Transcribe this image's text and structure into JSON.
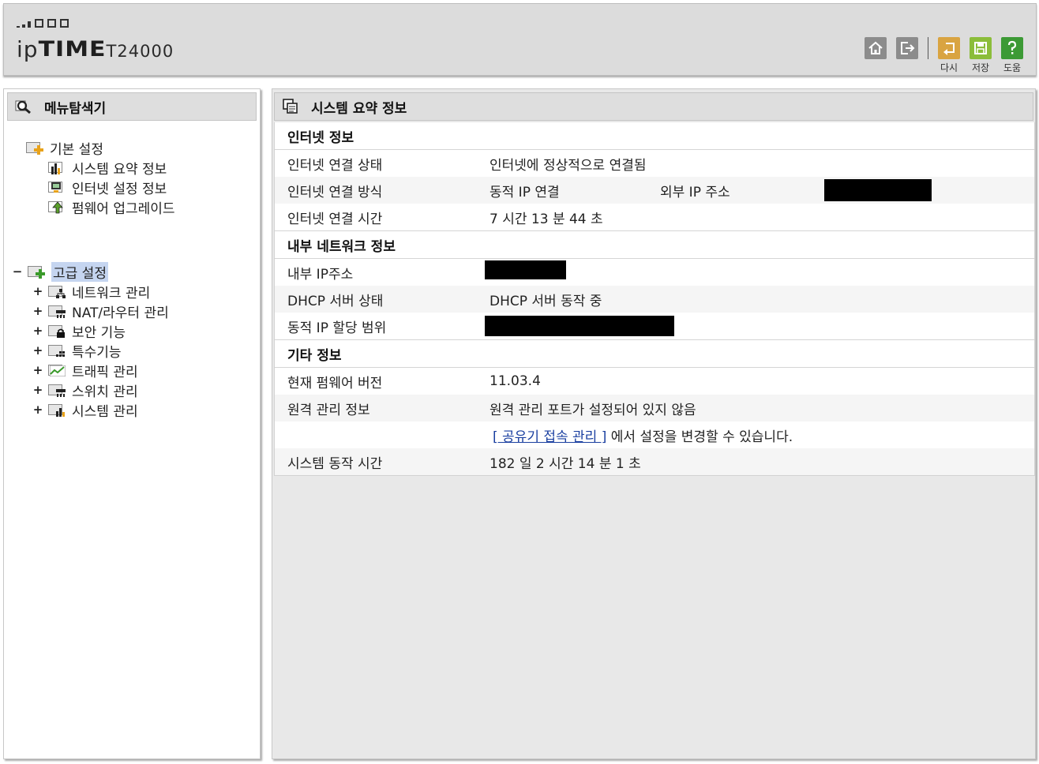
{
  "header": {
    "logo_ip": "ip",
    "logo_time": "TIME",
    "logo_model": "T24000",
    "buttons": {
      "home_label": "",
      "logout_label": "",
      "reload_label": "다시",
      "save_label": "저장",
      "help_label": "도움"
    }
  },
  "menu": {
    "title": "메뉴탐색기",
    "basic": {
      "label": "기본 설정",
      "items": [
        "시스템 요약 정보",
        "인터넷 설정 정보",
        "펌웨어 업그레이드"
      ]
    },
    "advanced": {
      "toggle": "−",
      "label": "고급 설정",
      "items": [
        "네트워크 관리",
        "NAT/라우터 관리",
        "보안 기능",
        "특수기능",
        "트래픽 관리",
        "스위치 관리",
        "시스템 관리"
      ],
      "expander": "+"
    }
  },
  "main": {
    "title": "시스템 요약 정보",
    "internet": {
      "section": "인터넷 정보",
      "status_label": "인터넷 연결 상태",
      "status_value": "인터넷에 정상적으로 연결됨",
      "method_label": "인터넷 연결 방식",
      "method_value": "동적 IP 연결",
      "external_ip_label": "외부 IP 주소",
      "uptime_label": "인터넷 연결 시간",
      "uptime_value": "7 시간 13 분 44 초"
    },
    "lan": {
      "section": "내부 네트워크 정보",
      "ip_label": "내부 IP주소",
      "dhcp_label": "DHCP 서버 상태",
      "dhcp_value": "DHCP 서버 동작 중",
      "range_label": "동적 IP 할당 범위"
    },
    "etc": {
      "section": "기타 정보",
      "fw_label": "현재 펌웨어 버전",
      "fw_value": "11.03.4",
      "remote_label": "원격 관리 정보",
      "remote_value": "원격 관리 포트가 설정되어 있지 않음",
      "remote_link": "[ 공유기 접속 관리 ]",
      "remote_suffix": " 에서 설정을 변경할 수 있습니다.",
      "sys_uptime_label": "시스템 동작 시간",
      "sys_uptime_value": "182 일 2 시간 14 분 1 초"
    }
  }
}
